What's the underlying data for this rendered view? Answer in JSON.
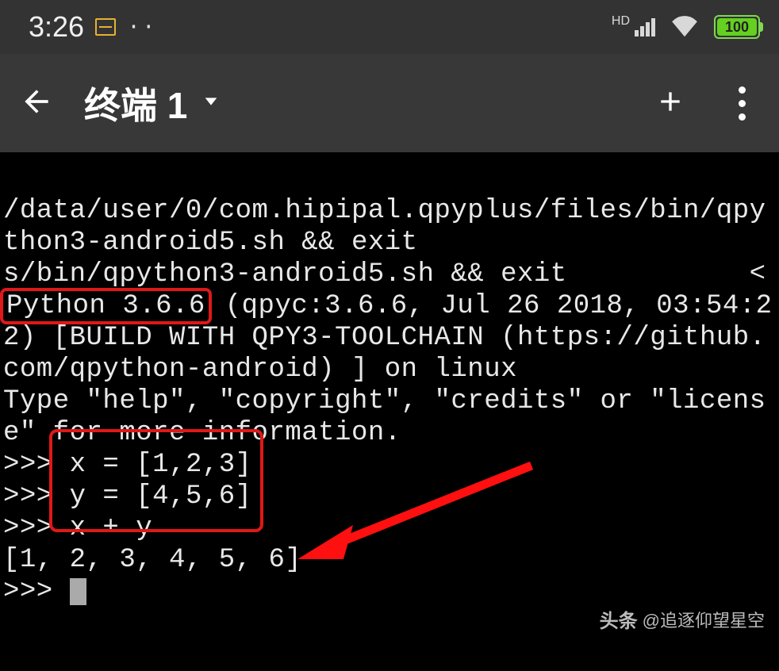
{
  "status": {
    "time": "3:26",
    "dots": "··",
    "hd": "HD",
    "battery": "100"
  },
  "appbar": {
    "title": "终端 1"
  },
  "terminal": {
    "l1": "/data/user/0/com.hipipal.qpyplus/files/bin/qpy",
    "l2": "thon3-android5.sh && exit",
    "l3a": "s/bin/qpython3-android5.sh && exit",
    "l3b": "<",
    "l4a": "Python 3.6.6",
    "l4b": " (qpyc:3.6.6, Jul 26 2018, 03:54:2",
    "l5": "2) [BUILD WITH QPY3-TOOLCHAIN (https://github.",
    "l6": "com/qpython-android) ] on linux",
    "l7": "Type \"help\", \"copyright\", \"credits\" or \"licens",
    "l8": "e\" for more information.",
    "p1": ">>> ",
    "c1": "x = [1,2,3]",
    "p2": ">>> ",
    "c2": "y = [4,5,6]",
    "p3": ">>> ",
    "c3": "x + y",
    "l12": "[1, 2, 3, 4, 5, 6]",
    "p4": ">>> "
  },
  "watermark": {
    "prefix": "头条",
    "user": "@追逐仰望星空"
  }
}
